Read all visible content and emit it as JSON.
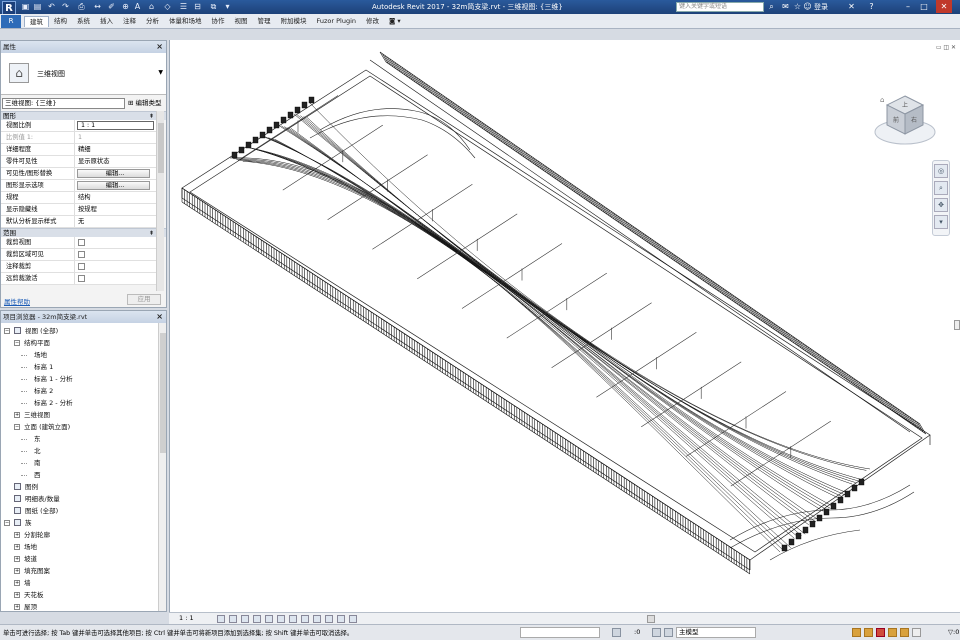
{
  "titlebar": {
    "logo": "R",
    "title": "Autodesk Revit 2017 -     32m简支梁.rvt - 三维视图: {三维}",
    "search_placeholder": "键入关键字或短语",
    "login": "登录",
    "help": "?"
  },
  "ribbon": {
    "file_label": "R",
    "tabs": [
      "建筑",
      "结构",
      "系统",
      "插入",
      "注释",
      "分析",
      "体量和场地",
      "协作",
      "视图",
      "管理",
      "附加模块",
      "Fuzor Plugin",
      "修改",
      "◙ ▾"
    ]
  },
  "properties": {
    "header": "属性",
    "type_name": "三维视图",
    "instance": "三维视图: {三维}",
    "edit_type": "编辑类型",
    "graphics_group": "图形",
    "extents_group": "范围",
    "rows": [
      {
        "label": "视图比例",
        "value": "1 : 1",
        "style": "boxed"
      },
      {
        "label": "比例值 1:",
        "value": "1",
        "style": "gray"
      },
      {
        "label": "详细程度",
        "value": "精细",
        "style": ""
      },
      {
        "label": "零件可见性",
        "value": "显示原状态",
        "style": ""
      },
      {
        "label": "可见性/图形替换",
        "value": "编辑...",
        "style": "btn"
      },
      {
        "label": "图形显示选项",
        "value": "编辑...",
        "style": "btn"
      },
      {
        "label": "规程",
        "value": "结构",
        "style": ""
      },
      {
        "label": "显示隐藏线",
        "value": "按规程",
        "style": ""
      },
      {
        "label": "默认分析显示样式",
        "value": "无",
        "style": ""
      }
    ],
    "extent_rows": [
      {
        "label": "裁剪视图"
      },
      {
        "label": "裁剪区域可见"
      },
      {
        "label": "注释裁剪"
      },
      {
        "label": "远剪裁激活"
      }
    ],
    "help_link": "属性帮助",
    "apply": "应用"
  },
  "browser": {
    "header": "项目浏览器 - 32m简支梁.rvt",
    "nodes": [
      {
        "label": "视图 (全部)",
        "level": 0,
        "exp": "−"
      },
      {
        "label": "结构平面",
        "level": 1,
        "exp": "−"
      },
      {
        "label": "场地",
        "level": 2,
        "exp": ""
      },
      {
        "label": "标高 1",
        "level": 2,
        "exp": ""
      },
      {
        "label": "标高 1 - 分析",
        "level": 2,
        "exp": ""
      },
      {
        "label": "标高 2",
        "level": 2,
        "exp": ""
      },
      {
        "label": "标高 2 - 分析",
        "level": 2,
        "exp": ""
      },
      {
        "label": "三维视图",
        "level": 1,
        "exp": "+"
      },
      {
        "label": "立面 (建筑立面)",
        "level": 1,
        "exp": "−"
      },
      {
        "label": "东",
        "level": 2,
        "exp": ""
      },
      {
        "label": "北",
        "level": 2,
        "exp": ""
      },
      {
        "label": "南",
        "level": 2,
        "exp": ""
      },
      {
        "label": "西",
        "level": 2,
        "exp": ""
      },
      {
        "label": "图例",
        "level": 0,
        "exp": "",
        "icon": true
      },
      {
        "label": "明细表/数量",
        "level": 0,
        "exp": "",
        "icon": true
      },
      {
        "label": "图纸 (全部)",
        "level": 0,
        "exp": "",
        "icon": true
      },
      {
        "label": "族",
        "level": 0,
        "exp": "−",
        "icon": true
      },
      {
        "label": "分割轮廓",
        "level": 1,
        "exp": "+"
      },
      {
        "label": "场地",
        "level": 1,
        "exp": "+"
      },
      {
        "label": "坡道",
        "level": 1,
        "exp": "+"
      },
      {
        "label": "填充图案",
        "level": 1,
        "exp": "+"
      },
      {
        "label": "墙",
        "level": 1,
        "exp": "+"
      },
      {
        "label": "天花板",
        "level": 1,
        "exp": "+"
      },
      {
        "label": "屋顶",
        "level": 1,
        "exp": "+"
      },
      {
        "label": "常规模型",
        "level": 1,
        "exp": "−"
      }
    ]
  },
  "viewport": {
    "controls": "▭ ◫ ✕",
    "viewcube_top": "上",
    "viewcube_front": "前",
    "viewcube_right": "右"
  },
  "view_control": {
    "scale": "1 : 1"
  },
  "status": {
    "text": "单击可进行选择; 按 Tab 键并单击可选择其他项目; 按 Ctrl 键并单击可将新项目添加到选择集; 按 Shift 键并单击可取消选择。",
    "selected": ":0",
    "model": "主模型",
    "filter": "▽:0"
  }
}
